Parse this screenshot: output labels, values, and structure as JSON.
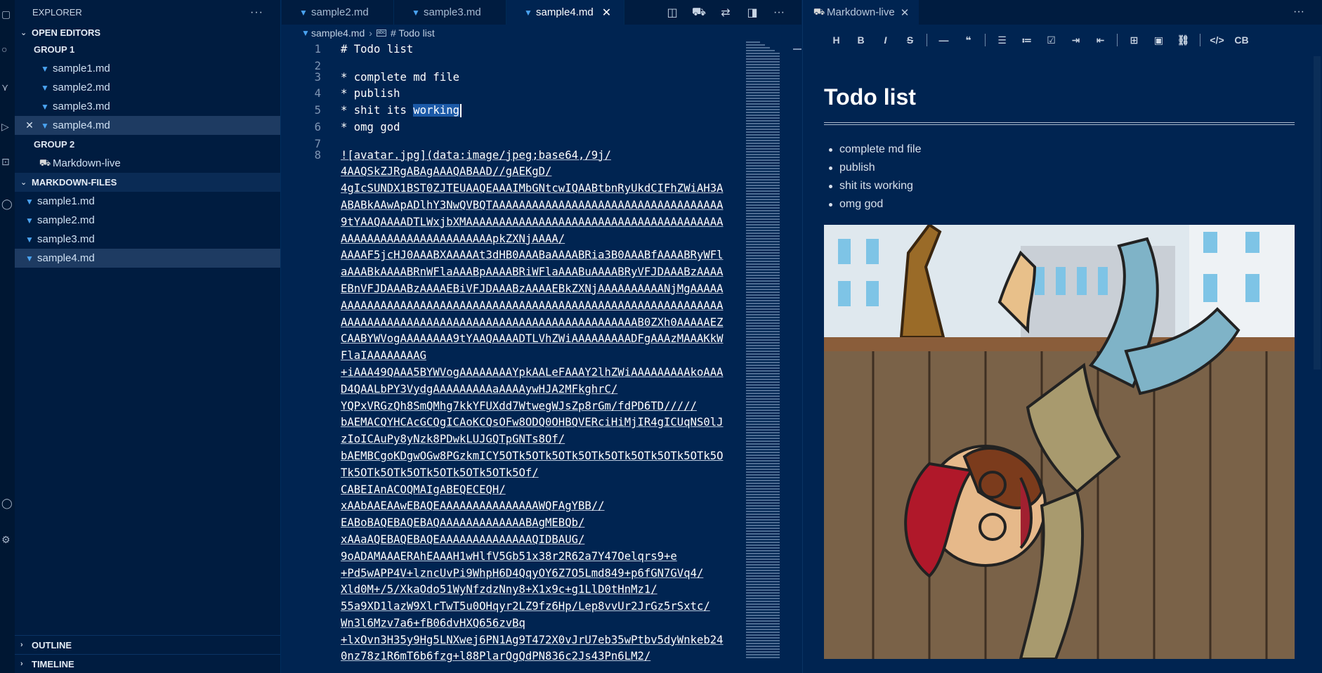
{
  "sidebar": {
    "title": "EXPLORER",
    "more": "···",
    "open_editors": {
      "label": "OPEN EDITORS",
      "groups": [
        {
          "label": "GROUP 1",
          "items": [
            "sample1.md",
            "sample2.md",
            "sample3.md",
            "sample4.md"
          ]
        },
        {
          "label": "GROUP 2",
          "items": [
            "Markdown-live"
          ]
        }
      ]
    },
    "markdown_files": {
      "label": "MARKDOWN-FILES",
      "items": [
        "sample1.md",
        "sample2.md",
        "sample3.md",
        "sample4.md"
      ]
    },
    "outline": "OUTLINE",
    "timeline": "TIMELINE"
  },
  "editor": {
    "tabs": [
      "sample2.md",
      "sample3.md",
      "sample4.md"
    ],
    "breadcrumb": {
      "file": "sample4.md",
      "symbol": "# Todo list"
    },
    "lines": [
      {
        "n": "1",
        "text": "# Todo list"
      },
      {
        "n": "2",
        "text": ""
      },
      {
        "n": "3",
        "text": "* complete md file"
      },
      {
        "n": "4",
        "text": "* publish"
      },
      {
        "n": "5",
        "before": "* shit its ",
        "selected": "working"
      },
      {
        "n": "6",
        "text": "* omg god"
      },
      {
        "n": "7",
        "text": ""
      },
      {
        "n": "8",
        "text": "![avatar.jpg](data:image/jpeg;base64,/9j/"
      }
    ],
    "wrapped": [
      "4AAQSkZJRgABAgAAAQABAAD//gAEKgD/",
      "4gIcSUNDX1BST0ZJTEUAAQEAAAIMbGNtcwIQAABtbnRyUkdCIFhZWiAH3A",
      "ABABkAAwApADlhY3NwQVBQTAAAAAAAAAAAAAAAAAAAAAAAAAAAAAAAAAAA",
      "9tYAAQAAAADTLWxjbXMAAAAAAAAAAAAAAAAAAAAAAAAAAAAAAAAAAAAAAA",
      "AAAAAAAAAAAAAAAAAAAAAAApkZXNjAAAA/",
      "AAAAF5jcHJ0AAABXAAAAAt3dHB0AAABaAAAABRia3B0AAABfAAAABRyWFl",
      "aAAABkAAAABRnWFlaAAABpAAAABRiWFlaAAABuAAAABRyVFJDAAABzAAAA",
      "EBnVFJDAAABzAAAAEBiVFJDAAABzAAAAEBkZXNjAAAAAAAAAANjMgAAAAA",
      "AAAAAAAAAAAAAAAAAAAAAAAAAAAAAAAAAAAAAAAAAAAAAAAAAAAAAAAAAA",
      "AAAAAAAAAAAAAAAAAAAAAAAAAAAAAAAAAAAAAAAAAAAAAB0ZXh0AAAAAEZ",
      "CAABYWVogAAAAAAAA9tYAAQAAAADTLVhZWiAAAAAAAAADFgAAAzMAAAKkW",
      "FlaIAAAAAAAAG",
      "+iAAA49QAAA5BYWVogAAAAAAAAYpkAALeFAAAY2lhZWiAAAAAAAAAkoAAA",
      "D4QAALbPY3VydgAAAAAAAAAaAAAAywHJA2MFkghrC/",
      "YQPxVRGzQh8SmQMhg7kkYFUXdd7WtwegWJsZp8rGm/fdPD6TD/////",
      "bAEMACQYHCAcGCQgICAoKCQsOFw8ODQ0OHBQVERciHiMjIR4gICUqNS0lJ",
      "zIoICAuPy8yNzk8PDwkLUJGQTpGNTs8Of/",
      "bAEMBCgoKDgwOGw8PGzkmICY5OTk5OTk5OTk5OTk5OTk5OTk5OTk5OTk5O",
      "Tk5OTk5OTk5OTk5OTk5OTk5OTk5Of/",
      "CABEIAnACOQMAIgABEQECEQH/",
      "xAAbAAEAAwEBAQEAAAAAAAAAAAAAAAWQFAgYBB//",
      "EABoBAQEBAQEBAQAAAAAAAAAAAAABAgMEBQb/",
      "xAAaAQEBAQEBAQEAAAAAAAAAAAAAAQIDBAUG/",
      "9oADAMAAAERAhEAAAH1wHlfV5Gb51x38r2R62a7Y47Oelqrs9+e",
      "+Pd5wAPP4V+lzncUvPi9WhpH6D4QqyOY6Z7O5Lmd849+p6fGN7GVq4/",
      "Xld0M+/5/XkaOdo51WyNfzdzNny8+X1x9c+g1LlD0tHnMz1/",
      "55a9XD1lazW9XlrTwT5u0OHqyr2LZ9fz6Hp/Lep8vvUr2JrGz5rSxtc/",
      "Wn3l6Mzv7a6+fB06dvHXQ656zvBq",
      "+lxOvn3H35y9Hg5LNXwej6PN1Ag9T472X0vJrU7eb35wPtbv5dyWnkeb24",
      "0nz78z1R6mT6b6fzg+l88PlarQgQdPN836c2Js43Pn6LM2/"
    ]
  },
  "preview": {
    "tab": "Markdown-live",
    "more": "···",
    "toolbar": [
      "H",
      "B",
      "I",
      "S",
      "—",
      "❝",
      "☰",
      "≔",
      "☑",
      "⇥",
      "⇤",
      "⊞",
      "▣",
      "⛓",
      "</>",
      "CB"
    ],
    "title": "Todo list",
    "items": [
      "complete md file",
      "publish",
      "shit its working",
      "omg god"
    ]
  },
  "colors": {
    "editor_bg": "#002451",
    "sidebar_bg": "#001c40",
    "selection": "#1c5aa8",
    "md_icon": "#4aa3f0"
  }
}
